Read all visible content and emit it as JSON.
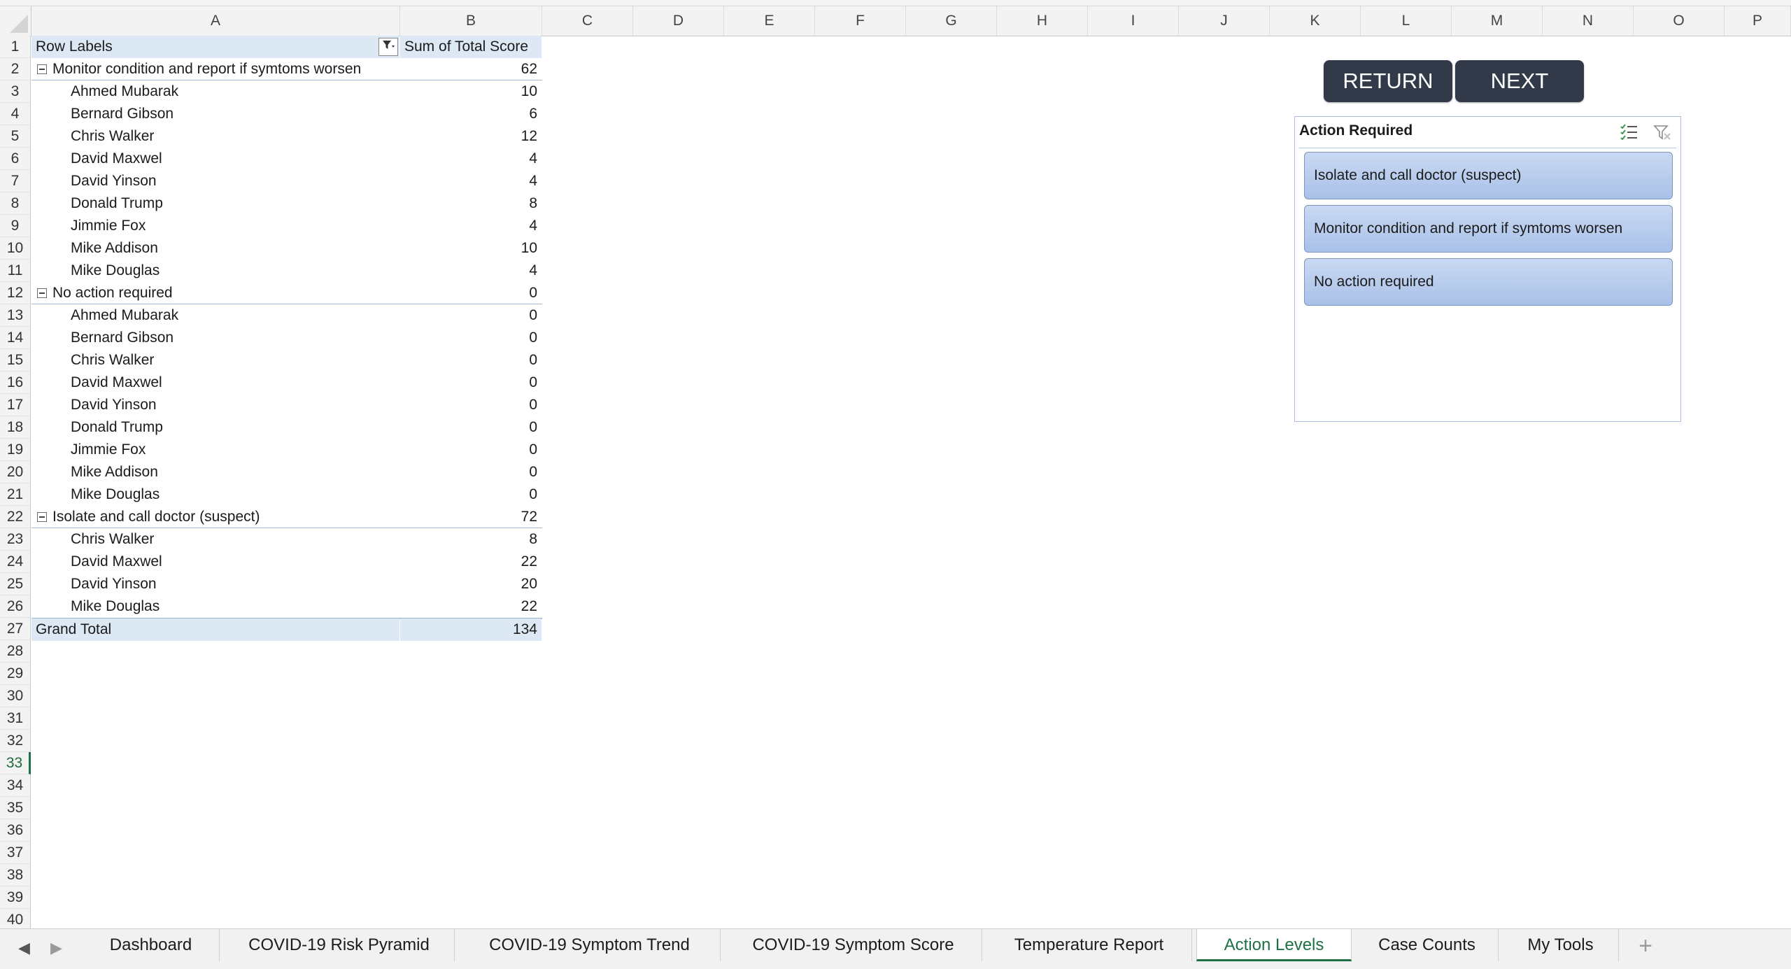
{
  "column_headers": [
    "A",
    "B",
    "C",
    "D",
    "E",
    "F",
    "G",
    "H",
    "I",
    "J",
    "K",
    "L",
    "M",
    "N",
    "O",
    "P"
  ],
  "row_numbers": [
    "1",
    "2",
    "3",
    "4",
    "5",
    "6",
    "7",
    "8",
    "9",
    "10",
    "11",
    "12",
    "13",
    "14",
    "15",
    "16",
    "17",
    "18",
    "19",
    "20",
    "21",
    "22",
    "23",
    "24",
    "25",
    "26",
    "27",
    "28",
    "29",
    "30",
    "31",
    "32",
    "33",
    "34",
    "35",
    "36",
    "37",
    "38",
    "39",
    "40"
  ],
  "active_row": "33",
  "pivot": {
    "header_row_labels": "Row Labels",
    "header_values": "Sum of Total Score",
    "groups": [
      {
        "label": "Monitor condition and report if symtoms worsen",
        "value": "62",
        "items": [
          {
            "name": "Ahmed Mubarak",
            "value": "10"
          },
          {
            "name": "Bernard Gibson",
            "value": "6"
          },
          {
            "name": "Chris Walker",
            "value": "12"
          },
          {
            "name": "David Maxwel",
            "value": "4"
          },
          {
            "name": "David Yinson",
            "value": "4"
          },
          {
            "name": "Donald Trump",
            "value": "8"
          },
          {
            "name": "Jimmie Fox",
            "value": "4"
          },
          {
            "name": "Mike Addison",
            "value": "10"
          },
          {
            "name": "Mike Douglas",
            "value": "4"
          }
        ]
      },
      {
        "label": "No action required",
        "value": "0",
        "items": [
          {
            "name": "Ahmed Mubarak",
            "value": "0"
          },
          {
            "name": "Bernard Gibson",
            "value": "0"
          },
          {
            "name": "Chris Walker",
            "value": "0"
          },
          {
            "name": "David Maxwel",
            "value": "0"
          },
          {
            "name": "David Yinson",
            "value": "0"
          },
          {
            "name": "Donald Trump",
            "value": "0"
          },
          {
            "name": "Jimmie Fox",
            "value": "0"
          },
          {
            "name": "Mike Addison",
            "value": "0"
          },
          {
            "name": "Mike Douglas",
            "value": "0"
          }
        ]
      },
      {
        "label": "Isolate and call doctor (suspect)",
        "value": "72",
        "items": [
          {
            "name": "Chris Walker",
            "value": "8"
          },
          {
            "name": "David Maxwel",
            "value": "22"
          },
          {
            "name": "David Yinson",
            "value": "20"
          },
          {
            "name": "Mike Douglas",
            "value": "22"
          }
        ]
      }
    ],
    "grand_total_label": "Grand Total",
    "grand_total_value": "134"
  },
  "buttons": {
    "return_label": "RETURN",
    "next_label": "NEXT"
  },
  "slicer": {
    "title": "Action Required",
    "items": [
      "Isolate and call doctor (suspect)",
      "Monitor condition and report if symtoms worsen",
      "No action required"
    ]
  },
  "sheet_tabs": [
    "Dashboard",
    "COVID-19 Risk Pyramid",
    "COVID-19 Symptom Trend",
    "COVID-19 Symptom Score",
    "Temperature Report",
    "Action Levels",
    "Case Counts",
    "My Tools"
  ],
  "active_tab": "Action Levels",
  "colors": {
    "accent_green": "#1e7145",
    "pivot_header_bg": "#dde8f5",
    "button_bg": "#323a49",
    "slicer_item_bg": "#b9ccee"
  }
}
